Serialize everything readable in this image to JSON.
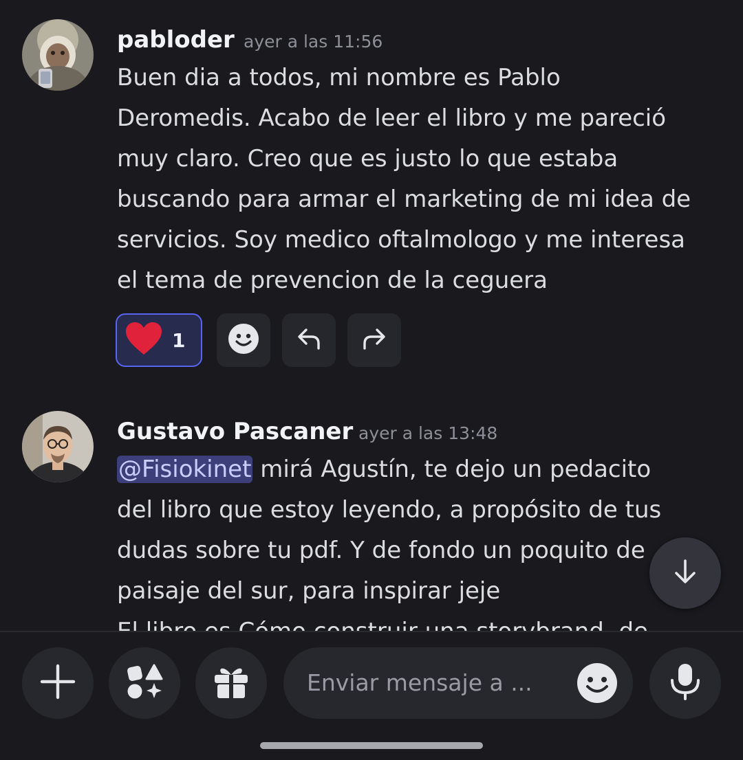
{
  "messages": [
    {
      "author": "pabloder",
      "timestamp": "ayer a las 11:56",
      "text": "Buen dia a todos, mi nombre es Pablo\nDeromedis. Acabo de leer el libro y me pareció\nmuy claro. Creo que es justo lo que estaba\nbuscando para armar el marketing de mi idea de\nservicios. Soy medico oftalmologo y me interesa\nel tema de prevencion de la ceguera",
      "reaction": {
        "emoji": "heart-icon",
        "count": "1"
      }
    },
    {
      "author": "Gustavo Pascaner",
      "timestamp": "ayer a las 13:48",
      "mention": "@Fisiokinet",
      "text_after_mention": " mirá Agustín, te dejo un pedacito\ndel libro que estoy leyendo, a propósito de tus\ndudas sobre tu pdf. Y de fondo un poquito de\npaisaje del sur, para inspirar jeje\nEl libro es Cómo construir una storybrand, de"
    }
  ],
  "composer": {
    "placeholder": "Enviar mensaje a ..."
  },
  "icons": {
    "add": "plus-icon",
    "apps": "apps-icon",
    "gift": "gift-icon",
    "emoji": "emoji-icon",
    "mic": "microphone-icon",
    "reply": "reply-icon",
    "forward": "forward-icon",
    "scroll": "arrow-down-icon"
  },
  "colors": {
    "background": "#1a1a1e",
    "accent": "#5865f2",
    "heart": "#e0233a",
    "mention_bg": "#3c3f7a"
  }
}
